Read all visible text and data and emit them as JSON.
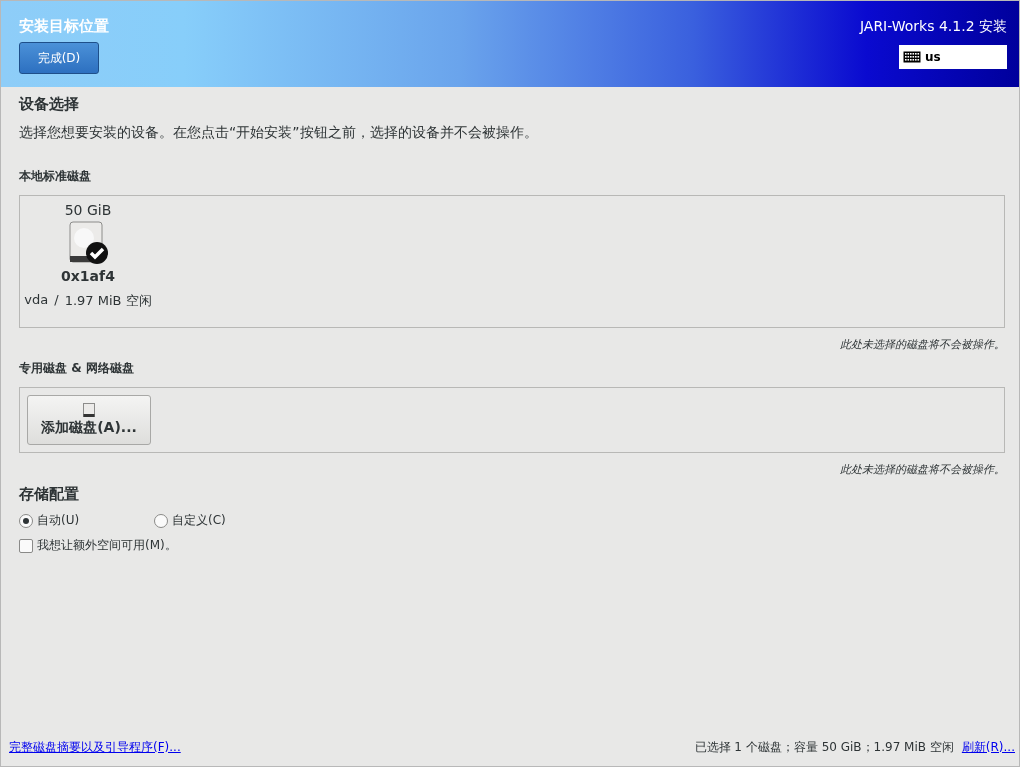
{
  "header": {
    "title": "安装目标位置",
    "done_button": "完成(D)",
    "product": "JARI-Works 4.1.2 安装",
    "keyboard": "us"
  },
  "device_selection": {
    "heading": "设备选择",
    "description": "选择您想要安装的设备。在您点击“开始安装”按钮之前，选择的设备并不会被操作。"
  },
  "local_disks": {
    "heading": "本地标准磁盘",
    "disks": [
      {
        "size": "50 GiB",
        "name": "0x1af4",
        "device": "vda",
        "separator": "/",
        "free": "1.97 MiB 空闲",
        "selected": true
      }
    ],
    "note": "此处未选择的磁盘将不会被操作。"
  },
  "specialized_disks": {
    "heading": "专用磁盘 & 网络磁盘",
    "add_button": "添加磁盘(A)...",
    "note": "此处未选择的磁盘将不会被操作。"
  },
  "storage": {
    "heading": "存储配置",
    "options": [
      {
        "label": "自动(U)",
        "selected": true
      },
      {
        "label": "自定义(C)",
        "selected": false
      }
    ],
    "extra_space": {
      "label": "我想让额外空间可用(M)。",
      "checked": false
    }
  },
  "footer": {
    "summary_link": "完整磁盘摘要以及引导程序(F)...",
    "status": "已选择 1 个磁盘；容量 50 GiB；1.97 MiB 空闲",
    "refresh_link": "刷新(R)..."
  }
}
